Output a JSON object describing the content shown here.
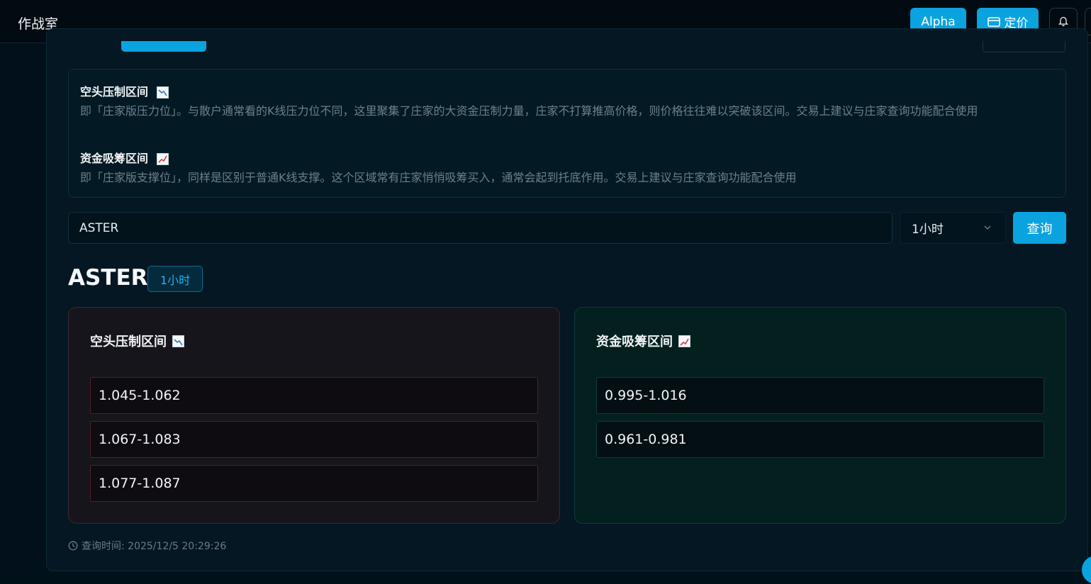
{
  "header": {
    "app_title": "作战室",
    "alpha_label": "Alpha",
    "pricing_label": "定价",
    "accent_color": "#0aa3df",
    "icons": [
      "card-icon",
      "bell-icon"
    ]
  },
  "info": {
    "short_title": "空头压制区间",
    "short_desc": "即「庄家版压力位」。与散户通常看的K线压力位不同，这里聚集了庄家的大资金压制力量，庄家不打算推高价格，则价格往往难以突破该区间。交易上建议与庄家查询功能配合使用",
    "long_title": "资金吸筹区间",
    "long_desc": "即「庄家版支撑位」，同样是区别于普通K线支撑。这个区域常有庄家悄悄吸筹买入，通常会起到托底作用。交易上建议与庄家查询功能配合使用"
  },
  "query": {
    "symbol_value": "ASTER",
    "timeframe_value": "1小时",
    "query_label": "查询"
  },
  "result": {
    "symbol": "ASTER",
    "timeframe": "1小时",
    "short_card_title": "空头压制区间",
    "long_card_title": "资金吸筹区间",
    "short_zones": [
      "1.045-1.062",
      "1.067-1.083",
      "1.077-1.087"
    ],
    "long_zones": [
      "0.995-1.016",
      "0.961-0.981"
    ],
    "query_time": "查询时间: 2025/12/5 20:29:26"
  }
}
